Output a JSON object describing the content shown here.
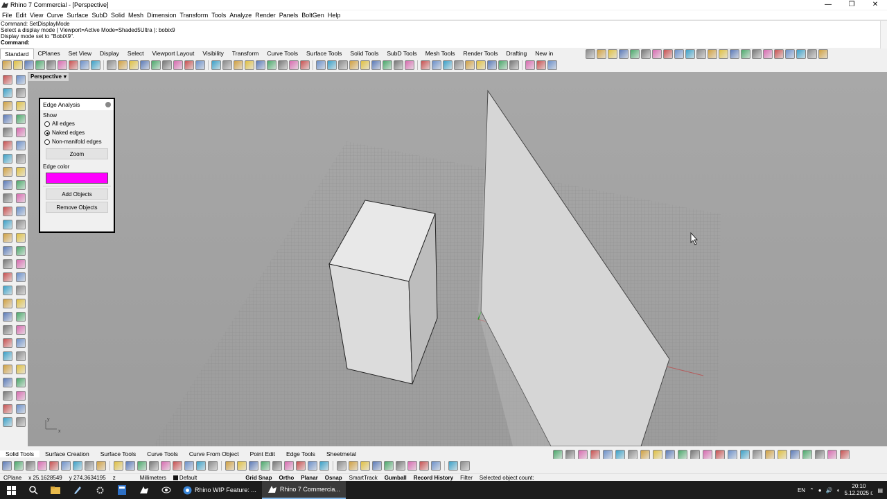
{
  "window": {
    "title": "Rhino 7 Commercial - [Perspective]",
    "controls": [
      "—",
      "❐",
      "✕"
    ]
  },
  "menu": [
    "File",
    "Edit",
    "View",
    "Curve",
    "Surface",
    "SubD",
    "Solid",
    "Mesh",
    "Dimension",
    "Transform",
    "Tools",
    "Analyze",
    "Render",
    "Panels",
    "BoltGen",
    "Help"
  ],
  "command_history": [
    "Command: SetDisplayMode",
    "Select a display mode ( Viewport=Active  Mode=Shaded5Ultra ): bobix9",
    "Display mode set to \"BobiX9\"."
  ],
  "command_prompt": "Command:",
  "toolbar_tabs": [
    "Standard",
    "CPlanes",
    "Set View",
    "Display",
    "Select",
    "Viewport Layout",
    "Visibility",
    "Transform",
    "Curve Tools",
    "Surface Tools",
    "Solid Tools",
    "SubD Tools",
    "Mesh Tools",
    "Render Tools",
    "Drafting",
    "New in"
  ],
  "viewport": {
    "label": "Perspective",
    "dropdown": "▾",
    "axis_y": "y",
    "axis_x": "x"
  },
  "edge_panel": {
    "title": "Edge Analysis",
    "show_label": "Show",
    "options": [
      {
        "label": "All edges",
        "selected": false
      },
      {
        "label": "Naked edges",
        "selected": true
      },
      {
        "label": "Non-manifold edges",
        "selected": false
      }
    ],
    "zoom_button": "Zoom",
    "edge_color_label": "Edge color",
    "edge_color": "#ff00ff",
    "add_button": "Add Objects",
    "remove_button": "Remove Objects"
  },
  "bottom_tabs": [
    "Solid Tools",
    "Surface Creation",
    "Surface Tools",
    "Curve Tools",
    "Curve From Object",
    "Point Edit",
    "Edge Tools",
    "Sheetmetal"
  ],
  "status": {
    "cplane": "CPlane",
    "x": "x 25.1628549",
    "y": "y 274.3634195",
    "z": "z",
    "units": "Millimeters",
    "layer": "Default",
    "grid_snap": "Grid Snap",
    "ortho": "Ortho",
    "planar": "Planar",
    "osnap": "Osnap",
    "smarttrack": "SmartTrack",
    "gumball": "Gumball",
    "record_history": "Record History",
    "filter": "Filter",
    "selected": "Selected object count:"
  },
  "taskbar": {
    "apps": [
      {
        "label": "Rhino WIP Feature: ...",
        "active": false
      },
      {
        "label": "Rhino 7 Commercia...",
        "active": true
      }
    ],
    "lang": "EN",
    "time": "20:10",
    "date": "5.12.2025 г."
  }
}
